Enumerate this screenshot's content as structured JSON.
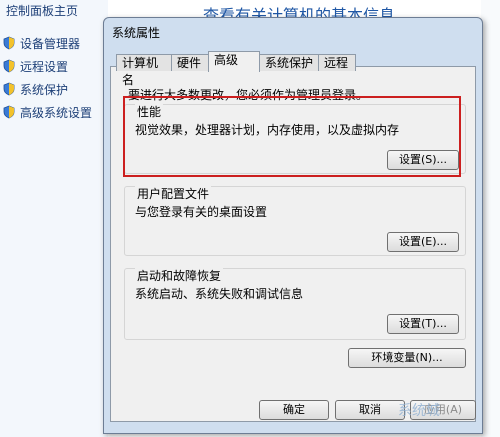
{
  "control_panel": {
    "home_link": "控制面板主页",
    "links": [
      {
        "label": "设备管理器",
        "icon": "shield-icon"
      },
      {
        "label": "远程设置",
        "icon": "shield-icon"
      },
      {
        "label": "系统保护",
        "icon": "shield-icon"
      },
      {
        "label": "高级系统设置",
        "icon": "shield-icon"
      }
    ],
    "page_title": "查看有关计算机的基本信息"
  },
  "dialog": {
    "title": "系统属性",
    "tabs": [
      "计算机名",
      "硬件",
      "高级",
      "系统保护",
      "远程"
    ],
    "active_tab": "高级",
    "notice": "要进行大多数更改，您必须作为管理员登录。",
    "performance": {
      "title": "性能",
      "description": "视觉效果，处理器计划，内存使用，以及虚拟内存",
      "button": "设置(S)..."
    },
    "user_profiles": {
      "title": "用户配置文件",
      "description": "与您登录有关的桌面设置",
      "button": "设置(E)..."
    },
    "startup_recovery": {
      "title": "启动和故障恢复",
      "description": "系统启动、系统失败和调试信息",
      "button": "设置(T)..."
    },
    "env_button": "环境变量(N)...",
    "ok_button": "确定",
    "cancel_button": "取消",
    "apply_button": "应用(A)"
  },
  "watermark": "系统城",
  "colors": {
    "highlight": "#cc1f1f",
    "link": "#1d3f77",
    "title_blue": "#1f57a5"
  }
}
